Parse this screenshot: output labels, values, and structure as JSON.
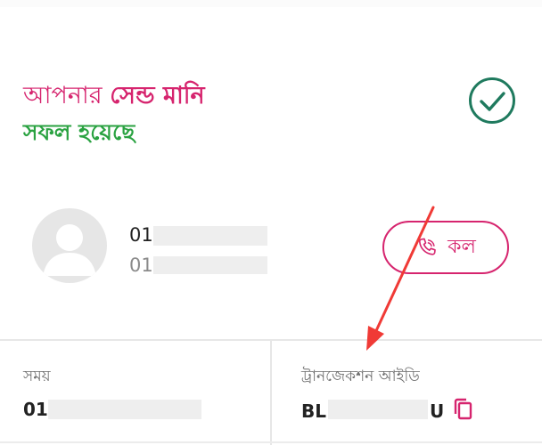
{
  "status": {
    "prefix": "আপনার ",
    "emphasis": "সেন্ড মানি",
    "result": "সফল হয়েছে"
  },
  "recipient": {
    "number_primary": "01",
    "number_secondary": "01"
  },
  "call_button": {
    "label": "কল"
  },
  "details": {
    "time_label": "সময়",
    "time_value": "01",
    "txn_label": "ট্রানজেকশন আইডি",
    "txn_value_start": "BL",
    "txn_value_end": "U"
  },
  "colors": {
    "brand": "#d6246e",
    "success": "#2aa241",
    "check_ring": "#1f7a5e",
    "annotation_arrow": "#f03a36"
  },
  "icons": {
    "status": "check-circle-icon",
    "avatar": "user-avatar-icon",
    "call": "phone-icon",
    "copy": "copy-icon"
  }
}
